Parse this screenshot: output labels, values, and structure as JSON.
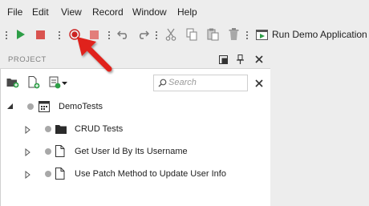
{
  "menu": [
    "File",
    "Edit",
    "View",
    "Record",
    "Window",
    "Help"
  ],
  "toolbar": {
    "run_demo_label": "Run Demo Application"
  },
  "panel": {
    "title": "PROJECT",
    "search_placeholder": "Search"
  },
  "tree": {
    "root": "DemoTests",
    "children": [
      "CRUD Tests",
      "Get User Id By Its Username",
      "Use Patch Method to Update User Info"
    ]
  },
  "colors": {
    "run_green": "#2e9e47",
    "stop_red": "#d9534f",
    "record_red": "#cc2222",
    "arrow_red": "#e0211b"
  }
}
